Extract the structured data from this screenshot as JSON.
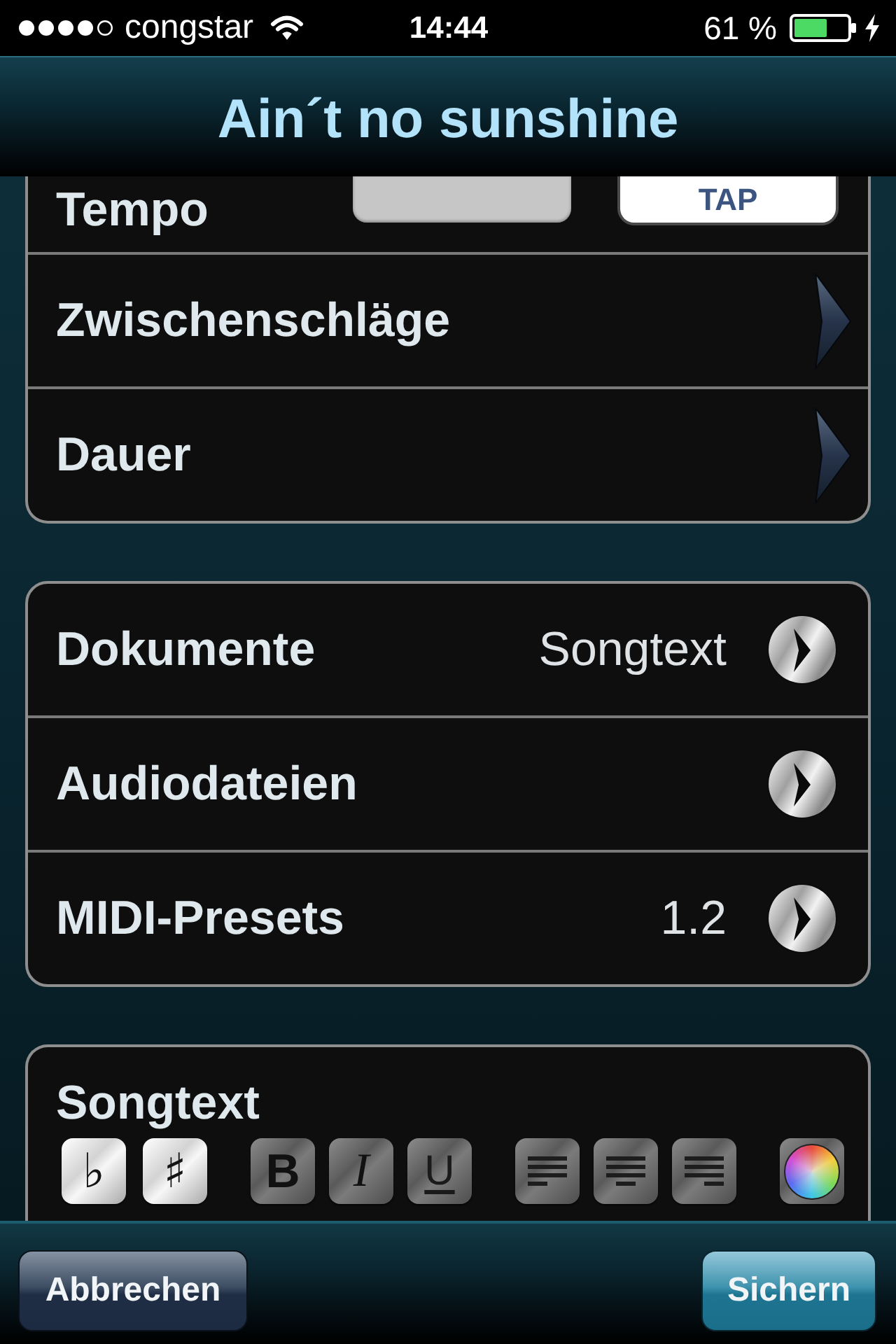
{
  "status_bar": {
    "carrier": "congstar",
    "time": "14:44",
    "battery": "61 %"
  },
  "nav_bar": {
    "title": "Ain´t no sunshine"
  },
  "sections": [
    {
      "kind": "list",
      "rows": [
        {
          "kind": "tempo",
          "label": "Tempo",
          "button": "TAP"
        },
        {
          "kind": "chevron",
          "label": "Zwischenschläge"
        },
        {
          "kind": "chevron",
          "label": "Dauer"
        }
      ]
    },
    {
      "kind": "list",
      "rows": [
        {
          "kind": "disclosure",
          "label": "Dokumente",
          "value": "Songtext"
        },
        {
          "kind": "disclosure",
          "label": "Audiodateien"
        },
        {
          "kind": "disclosure",
          "label": "MIDI-Presets",
          "value": "1.2"
        }
      ]
    },
    {
      "kind": "editor",
      "label": "Songtext",
      "format_buttons": [
        {
          "kind": "flat",
          "label": "♭"
        },
        {
          "kind": "sharp",
          "label": "♯"
        },
        {
          "kind": "bold",
          "label": "B"
        },
        {
          "kind": "italic",
          "label": "I"
        },
        {
          "kind": "underline",
          "label": "U"
        },
        {
          "kind": "align_left"
        },
        {
          "kind": "align_center"
        },
        {
          "kind": "align_right"
        },
        {
          "kind": "color"
        }
      ]
    }
  ],
  "toolbar": {
    "buttons": [
      {
        "kind": "cancel",
        "label": "Abbrechen"
      },
      {
        "kind": "save",
        "label": "Sichern"
      }
    ]
  }
}
